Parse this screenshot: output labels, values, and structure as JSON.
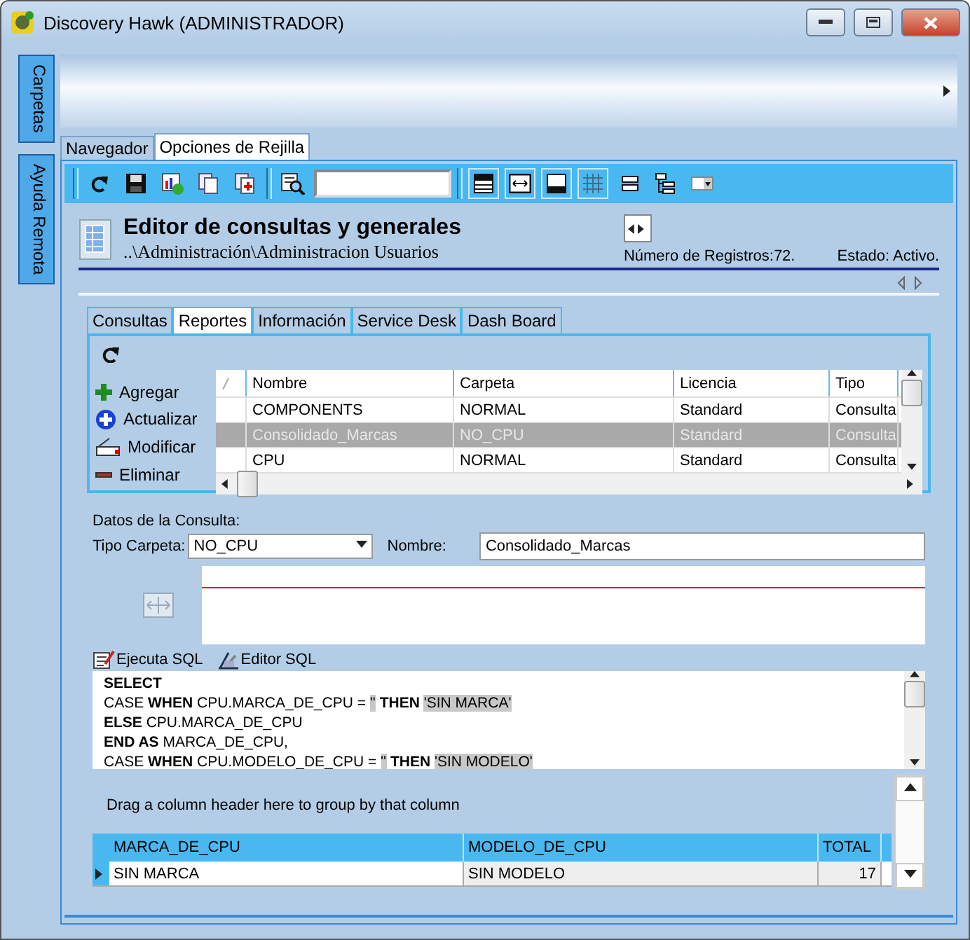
{
  "window": {
    "title": "Discovery Hawk (ADMINISTRADOR)"
  },
  "side_tabs": [
    {
      "label": "Carpetas"
    },
    {
      "label": "Ayuda Remota"
    }
  ],
  "main_tabs": [
    {
      "label": "Navegador",
      "selected": false
    },
    {
      "label": "Opciones de Rejilla",
      "selected": true
    }
  ],
  "header": {
    "title": "Editor de consultas y generales",
    "path": "..\\Administración\\Administracion Usuarios",
    "record_count": "Número de Registros:72.",
    "status": "Estado: Activo."
  },
  "report_tabs": [
    {
      "label": "Consultas",
      "selected": false
    },
    {
      "label": "Reportes",
      "selected": true
    },
    {
      "label": "Información",
      "selected": false
    },
    {
      "label": "Service Desk",
      "selected": false
    },
    {
      "label": "Dash Board",
      "selected": false
    }
  ],
  "actions": [
    {
      "label": "Agregar",
      "kind": "add"
    },
    {
      "label": "Actualizar",
      "kind": "update"
    },
    {
      "label": "Modificar",
      "kind": "edit"
    },
    {
      "label": "Eliminar",
      "kind": "delete"
    }
  ],
  "reports_table": {
    "columns": [
      "Nombre",
      "Carpeta",
      "Licencia",
      "Tipo"
    ],
    "rows": [
      {
        "cells": [
          "COMPONENTS",
          "NORMAL",
          "Standard",
          "Consulta"
        ],
        "selected": false
      },
      {
        "cells": [
          "Consolidado_Marcas",
          "NO_CPU",
          "Standard",
          "Consulta"
        ],
        "selected": true
      },
      {
        "cells": [
          "CPU",
          "NORMAL",
          "Standard",
          "Consulta"
        ],
        "selected": false
      }
    ]
  },
  "query": {
    "section_label": "Datos de la Consulta:",
    "folder_type_label": "Tipo Carpeta:",
    "folder_type": "NO_CPU",
    "name_label": "Nombre:",
    "name": "Consolidado_Marcas"
  },
  "sql_toolbar": [
    {
      "label": "Ejecuta SQL",
      "kind": "run"
    },
    {
      "label": "Editor SQL",
      "kind": "editor"
    }
  ],
  "sql_lines": [
    [
      {
        "text": "SELECT",
        "bold": true
      }
    ],
    [
      {
        "text": "CASE ",
        "bold": false
      },
      {
        "text": "WHEN ",
        "bold": true
      },
      {
        "text": "CPU.MARCA_DE_CPU = ",
        "bold": false
      },
      {
        "text": "''",
        "bold": false,
        "highlighted": true
      },
      {
        "text": " THEN ",
        "bold": true
      },
      {
        "text": "'SIN MARCA'",
        "bold": false,
        "highlighted": true
      }
    ],
    [
      {
        "text": "ELSE ",
        "bold": true
      },
      {
        "text": "CPU.MARCA_DE_CPU",
        "bold": false
      }
    ],
    [
      {
        "text": "END AS ",
        "bold": true
      },
      {
        "text": "MARCA_DE_CPU,",
        "bold": false
      }
    ],
    [
      {
        "text": "CASE ",
        "bold": false
      },
      {
        "text": "WHEN ",
        "bold": true
      },
      {
        "text": "CPU.MODELO_DE_CPU = ",
        "bold": false
      },
      {
        "text": "''",
        "bold": false,
        "highlighted": true
      },
      {
        "text": " THEN ",
        "bold": true
      },
      {
        "text": "'SIN MODELO'",
        "bold": false,
        "highlighted": true
      }
    ]
  ],
  "results": {
    "group_hint": "Drag a column header here to group by that column",
    "columns": [
      "MARCA_DE_CPU",
      "MODELO_DE_CPU",
      "TOTAL"
    ],
    "rows": [
      {
        "cells": [
          "SIN MARCA",
          "SIN MODELO",
          "17"
        ],
        "current": true
      }
    ]
  }
}
